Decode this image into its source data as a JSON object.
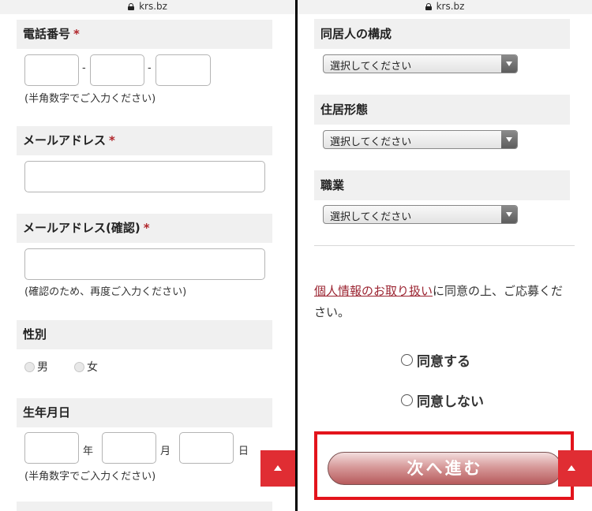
{
  "browser": {
    "domain": "krs.bz"
  },
  "left": {
    "phone": {
      "label": "電話番号",
      "required": "*",
      "dash": "-",
      "note": "(半角数字でご入力ください)"
    },
    "email": {
      "label": "メールアドレス",
      "required": "*"
    },
    "email_confirm": {
      "label": "メールアドレス(確認)",
      "required": "*",
      "note": "(確認のため、再度ご入力ください)"
    },
    "gender": {
      "label": "性別",
      "options": [
        "男",
        "女"
      ]
    },
    "birthdate": {
      "label": "生年月日",
      "units": [
        "年",
        "月",
        "日"
      ],
      "note": "(半角数字でご入力ください)"
    },
    "scroll_top_icon": "up-arrow-icon"
  },
  "right": {
    "household": {
      "label": "同居人の構成",
      "selected": "選択してください"
    },
    "residence": {
      "label": "住居形態",
      "selected": "選択してください"
    },
    "occupation": {
      "label": "職業",
      "selected": "選択してください"
    },
    "consent": {
      "link": "個人情報のお取り扱い",
      "text": "に同意の上、ご応募ください。"
    },
    "agree": {
      "options": [
        "同意する",
        "同意しない"
      ]
    },
    "next_button": "次へ進む"
  },
  "colors": {
    "required": "#b0252a",
    "top_button": "#e02d33",
    "highlight_frame": "#e3141c",
    "link": "#9b2431"
  }
}
